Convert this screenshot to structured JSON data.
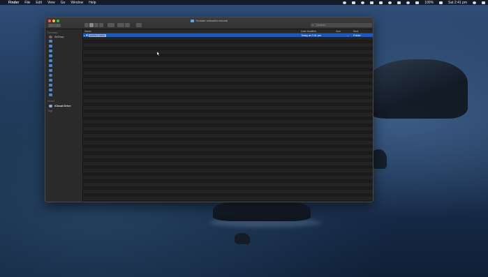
{
  "menubar": {
    "app_name": "Finder",
    "menus": [
      "File",
      "Edit",
      "View",
      "Go",
      "Window",
      "Help"
    ],
    "battery": "100%",
    "clock": "Sat 2:41 pm"
  },
  "window": {
    "title": "Youtube videos/for tutorial",
    "search_placeholder": "Search"
  },
  "sidebar": {
    "favorites_label": "Favorites",
    "items": [
      {
        "label": "AirDrop",
        "icon": "airdrop-icon"
      }
    ],
    "icloud_label": "iCloud",
    "icloud_drive": "iCloud Drive",
    "tags_label": "Tags"
  },
  "list": {
    "columns": {
      "name": "Name",
      "date": "Date Modified",
      "size": "Size",
      "kind": "Kind"
    },
    "selected_row": {
      "name": "untitled folder",
      "date": "Today at 2:41 pm",
      "size": "--",
      "kind": "Folder"
    }
  },
  "colors": {
    "selection": "#1659c9",
    "folder": "#6cb0f0"
  }
}
